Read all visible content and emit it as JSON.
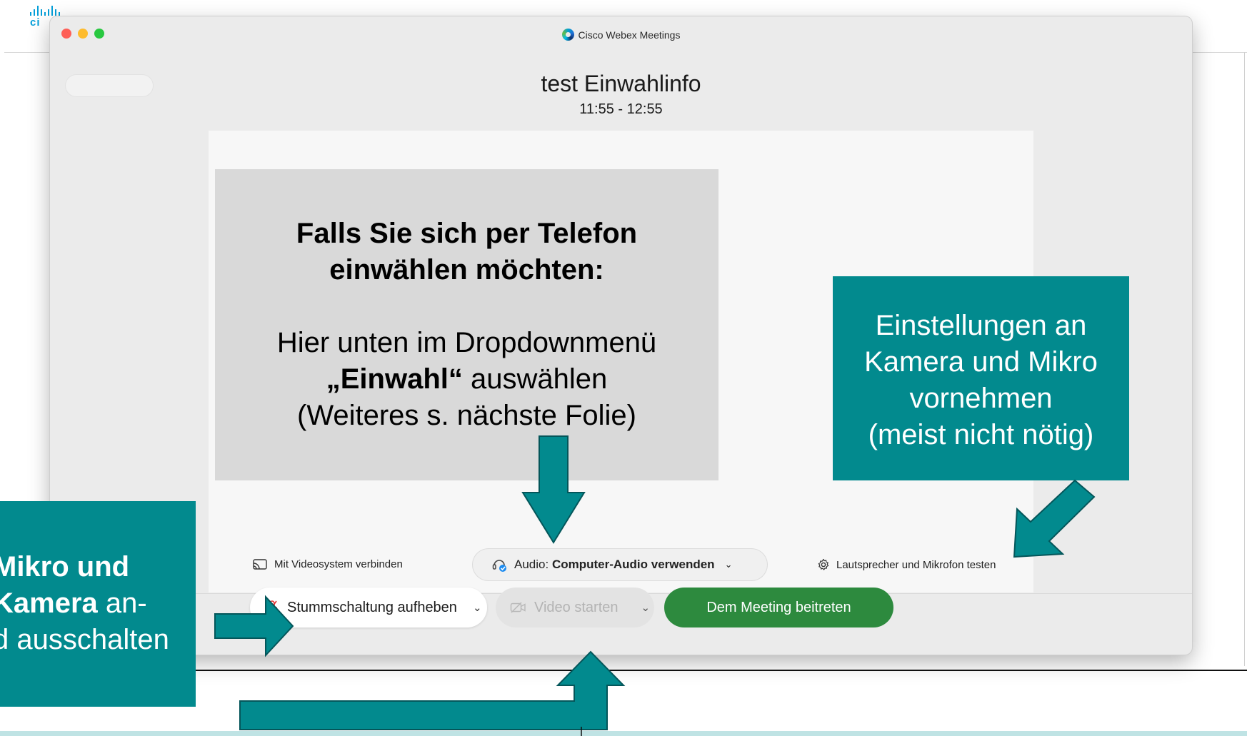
{
  "window": {
    "app_title": "Cisco Webex Meetings",
    "meeting_title": "test Einwahlinfo",
    "meeting_time": "11:55 - 12:55"
  },
  "options": {
    "video_system": "Mit Videosystem verbinden",
    "audio_prefix": "Audio: ",
    "audio_value": "Computer-Audio verwenden",
    "test_audio": "Lautsprecher und Mikrofon testen"
  },
  "controls": {
    "unmute": "Stummschaltung aufheben",
    "video": "Video starten",
    "join": "Dem Meeting beitreten"
  },
  "callouts": {
    "gray_head_line1": "Falls Sie sich per Telefon",
    "gray_head_line2": "einwählen möchten:",
    "gray_body_line1": "Hier unten im Dropdownmenü",
    "gray_body_bold": "„Einwahl“",
    "gray_body_line2_rest": " auswählen",
    "gray_body_line3": "(Weiteres s. nächste Folie)",
    "right_line1": "Einstellungen an",
    "right_line2": "Kamera und Mikro",
    "right_line3": "vornehmen",
    "right_line4": "(meist nicht nötig)",
    "left_bold1": "Mikro und",
    "left_bold2": "Kamera",
    "left_rest2": " an-",
    "left_line3": "d ausschalten"
  },
  "colors": {
    "teal": "#028a8e",
    "join_green": "#2d8a3e",
    "callout_gray": "#d9d9d9"
  }
}
